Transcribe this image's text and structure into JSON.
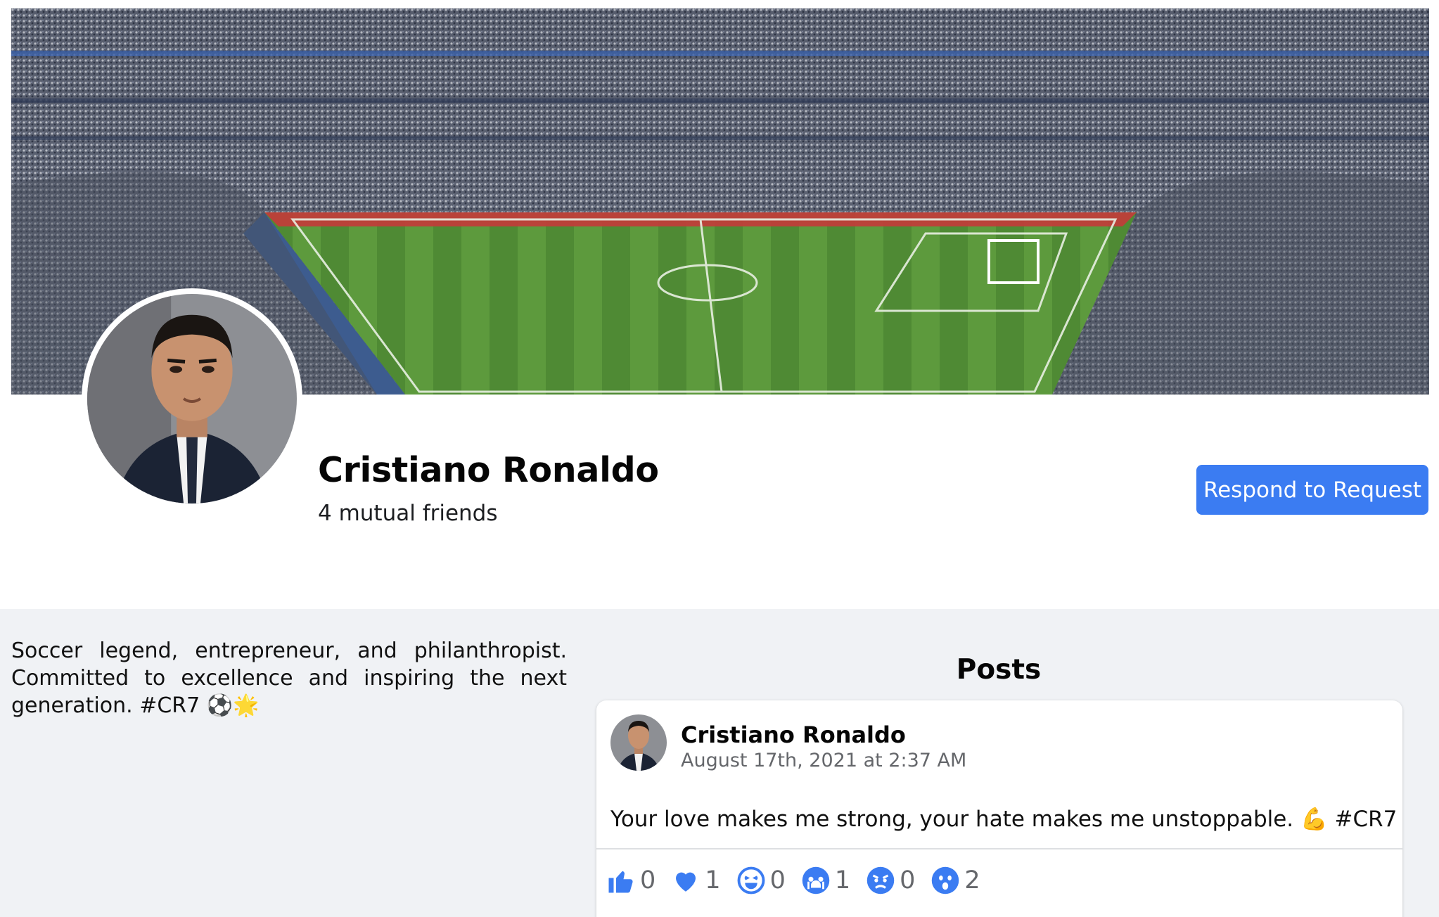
{
  "profile": {
    "name": "Cristiano Ronaldo",
    "mutual_friends": "4 mutual friends",
    "respond_button": "Respond to Request",
    "bio": "Soccer legend, entrepreneur, and philanthropist. Committed to excellence and inspiring the next generation. #CR7 ⚽🌟"
  },
  "posts_section": {
    "title": "Posts",
    "posts": [
      {
        "author": "Cristiano Ronaldo",
        "timestamp": "August 17th, 2021 at 2:37 AM",
        "text": "Your love makes me strong, your hate makes me unstoppable. 💪 #CR7",
        "reactions": [
          {
            "icon": "like-icon",
            "count": "0"
          },
          {
            "icon": "love-icon",
            "count": "1"
          },
          {
            "icon": "haha-icon",
            "count": "0"
          },
          {
            "icon": "sad-icon",
            "count": "1"
          },
          {
            "icon": "angry-icon",
            "count": "0"
          },
          {
            "icon": "wow-icon",
            "count": "2"
          }
        ]
      }
    ]
  },
  "colors": {
    "accent": "#3b7cf2",
    "section_bg": "#f0f2f5",
    "reaction_blue": "#3b7cf2"
  }
}
